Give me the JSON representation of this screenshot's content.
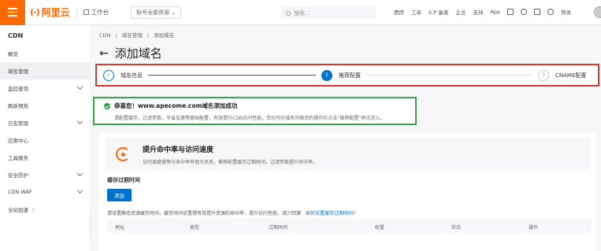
{
  "topbar": {
    "logo_mark": "(-)",
    "logo_text": "阿里云",
    "workbench": "工作台",
    "scope": "账号全部资源",
    "search_placeholder": "搜索...",
    "links": [
      "费用",
      "工单",
      "ICP 备案",
      "企业",
      "支持",
      "App"
    ],
    "lang": "简体"
  },
  "sidebar": {
    "title": "CDN",
    "items": [
      {
        "label": "概览",
        "chevron": false
      },
      {
        "label": "域名管理",
        "chevron": false,
        "active": true
      },
      {
        "label": "监控查询",
        "chevron": true
      },
      {
        "label": "刷新预热",
        "chevron": false
      },
      {
        "label": "日志管理",
        "chevron": true
      },
      {
        "label": "应用中心",
        "chevron": false
      },
      {
        "label": "工具服务",
        "chevron": false
      },
      {
        "label": "安全防护",
        "chevron": true
      },
      {
        "label": "CDN WAF",
        "chevron": true
      },
      {
        "label": "全站加速",
        "chevron": false,
        "external": true
      }
    ]
  },
  "breadcrumb": [
    "CDN",
    "/",
    "域名管理",
    "/",
    "添加域名"
  ],
  "page_title": "添加域名",
  "steps": [
    {
      "num": "✓",
      "label": "域名信息",
      "state": "done"
    },
    {
      "num": "2",
      "label": "推荐配置",
      "state": "active"
    },
    {
      "num": "3",
      "label": "CNAME配置",
      "state": "todo"
    }
  ],
  "success": {
    "title": "恭喜您！www.apecome.com域名添加成功",
    "desc": "请配置缓存，过滤参数，节省加速等基础配置，有效提升CDN访问性能。您也可在域名列表页的操作栏点击“推荐配置”再次进入。"
  },
  "optimize": {
    "title": "提升命中率与访问速度",
    "desc": "访问速度慢等与命中率有很大关系，推荐配置缓存过期时间，过滤参数提升命中率。"
  },
  "cache": {
    "label": "缓存过期时间",
    "add_button": "添加",
    "hint": "请设置静态资源缓存时间，缓存时间设置得有效提升资源的命中率，提升访问性能，减少回源",
    "link": "如何设置缓存过期时间?",
    "columns": [
      "地址",
      "类型",
      "过期时间",
      "权重",
      "状态",
      "操作"
    ]
  },
  "colors": {
    "accent": "#ff6a00",
    "primary": "#0070cc",
    "highlight_red": "#d9362d",
    "highlight_green": "#3fa34d"
  }
}
